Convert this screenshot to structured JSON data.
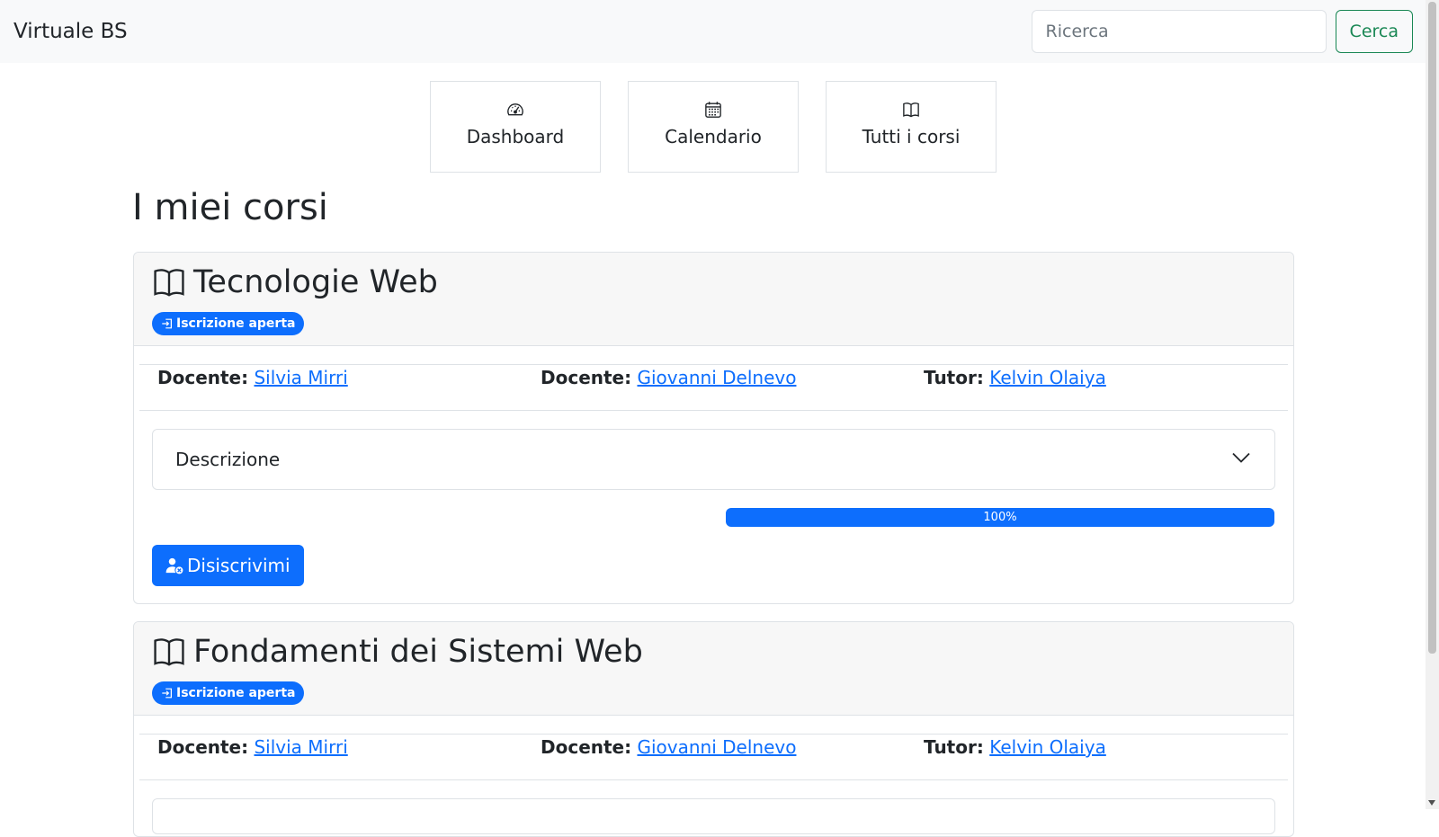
{
  "navbar": {
    "brand": "Virtuale BS",
    "search_placeholder": "Ricerca",
    "search_button": "Cerca"
  },
  "nav_tiles": [
    {
      "label": "Dashboard",
      "icon": "speedometer-icon"
    },
    {
      "label": "Calendario",
      "icon": "calendar-icon"
    },
    {
      "label": "Tutti i corsi",
      "icon": "book-icon"
    }
  ],
  "page_title": "I miei corsi",
  "courses": [
    {
      "title": "Tecnologie Web",
      "badge": "Iscrizione aperta",
      "staff": [
        {
          "role": "Docente:",
          "name": "Silvia Mirri"
        },
        {
          "role": "Docente:",
          "name": "Giovanni Delnevo"
        },
        {
          "role": "Tutor:",
          "name": "Kelvin Olaiya"
        }
      ],
      "accordion_label": "Descrizione",
      "progress": 100,
      "progress_label": "100%",
      "action_button": "Disiscrivimi"
    },
    {
      "title": "Fondamenti dei Sistemi Web",
      "badge": "Iscrizione aperta",
      "staff": [
        {
          "role": "Docente:",
          "name": "Silvia Mirri"
        },
        {
          "role": "Docente:",
          "name": "Giovanni Delnevo"
        },
        {
          "role": "Tutor:",
          "name": "Kelvin Olaiya"
        }
      ]
    }
  ],
  "colors": {
    "primary": "#0d6efd",
    "success": "#198754",
    "navbar_bg": "#f8f9fa",
    "card_header_bg": "#f7f7f7"
  }
}
